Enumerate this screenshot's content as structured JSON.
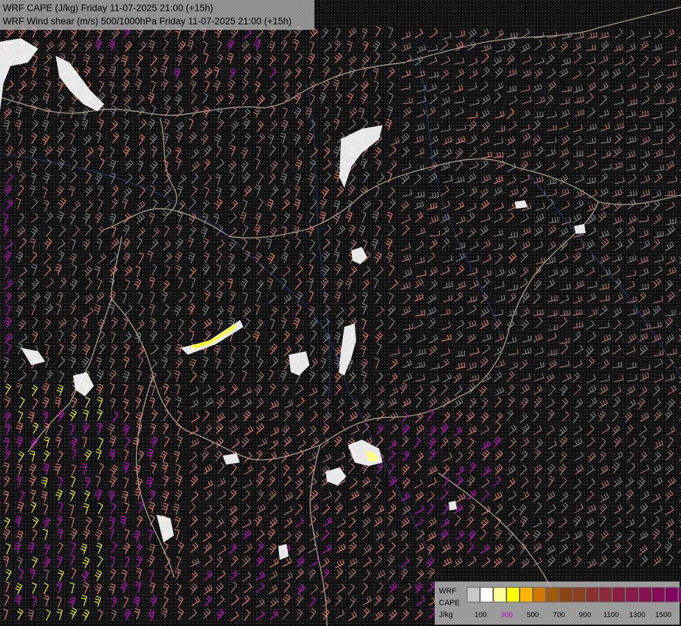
{
  "header": {
    "line1": "WRF CAPE (J/kg) Friday 11-07-2025 21:00 (+15h)",
    "line2": "WRF Wind shear (m/s) 500/1000hPa Friday 11-07-2025 21:00 (+15h)"
  },
  "legend": {
    "label_model": "WRF",
    "label_field": "CAPE",
    "label_unit": "J/kg",
    "swatches": [
      "#c8c8c8",
      "#ffffff",
      "#ffff99",
      "#ffff00",
      "#ffb400",
      "#d07800",
      "#a05a10",
      "#8b4513",
      "#8c4020",
      "#8c3030",
      "#8a2a3a",
      "#8a2040",
      "#8a1848",
      "#881050",
      "#860a58",
      "#840660",
      "#820068"
    ],
    "ticks": [
      {
        "label": "100",
        "color": "#000000"
      },
      {
        "label": "300",
        "color": "#cc00cc"
      },
      {
        "label": "500",
        "color": "#000000"
      },
      {
        "label": "700",
        "color": "#000000"
      },
      {
        "label": "900",
        "color": "#000000"
      },
      {
        "label": "1100",
        "color": "#000000"
      },
      {
        "label": "1300",
        "color": "#000000"
      },
      {
        "label": "1500",
        "color": "#000000"
      }
    ]
  },
  "colors": {
    "background": "#000000",
    "shear_weak": "#8a8a8a",
    "shear_mid": "#b87878",
    "shear_strong": "#f08070",
    "shear_very_strong": "#e000e0",
    "shear_extreme": "#ffff00",
    "borders": "#d8c8a0",
    "rivers": "#3050a0",
    "cape_low": "#ffffff"
  }
}
